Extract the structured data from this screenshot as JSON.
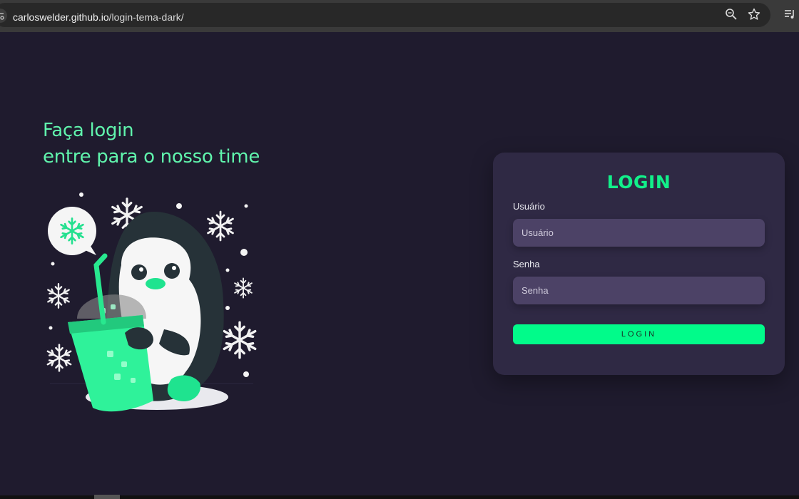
{
  "browser": {
    "url_host": "carloswelder.github.io",
    "url_path": "/login-tema-dark/"
  },
  "hero": {
    "line1": "Faça login",
    "line2": "entre para o nosso time"
  },
  "login": {
    "title": "LOGIN",
    "user_label": "Usuário",
    "user_placeholder": "Usuário",
    "user_value": "",
    "pass_label": "Senha",
    "pass_placeholder": "Senha",
    "pass_value": "",
    "button_label": "LOGIN"
  },
  "colors": {
    "background": "#1f1b2e",
    "accent": "#01fb8a",
    "card": "#2f2944",
    "input": "#4c4266"
  },
  "icons": [
    "site-info-icon",
    "zoom-icon",
    "bookmark-star-icon",
    "media-control-icon",
    "penguin-illustration",
    "snowflake-icon"
  ]
}
